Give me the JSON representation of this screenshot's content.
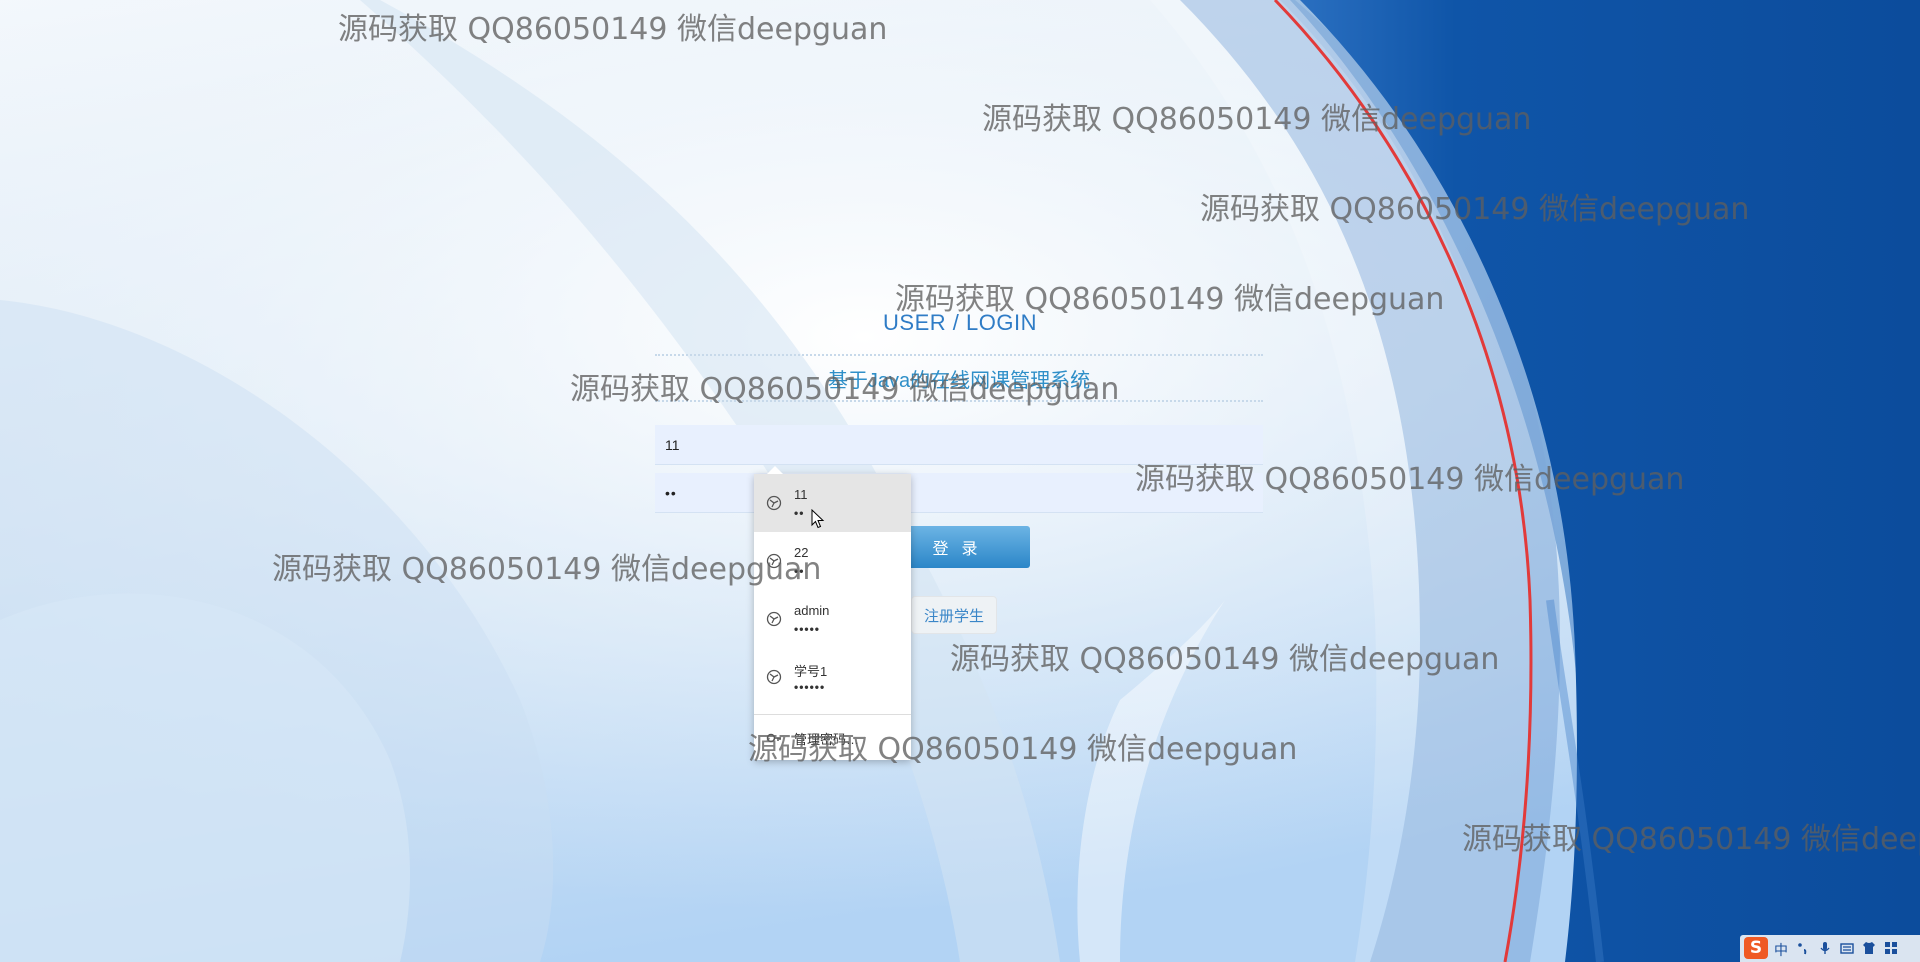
{
  "login": {
    "header": "USER / LOGIN",
    "system_title": "基于Java的在线网课管理系统",
    "username_value": "11",
    "password_value": "••",
    "login_button": "登 录",
    "register_button": "注册学生"
  },
  "autofill": {
    "items": [
      {
        "username": "11",
        "password": "••"
      },
      {
        "username": "22",
        "password": "••"
      },
      {
        "username": "admin",
        "password": "•••••"
      },
      {
        "username": "学号1",
        "password": "••••••"
      }
    ],
    "manage_label": "管理密码…"
  },
  "watermark_text": "源码获取 QQ86050149 微信deepguan",
  "ime": {
    "logo": "S",
    "language": "中",
    "icons": [
      "punctuation-icon",
      "microphone-icon",
      "keyboard-icon",
      "skin-icon",
      "toolbox-icon"
    ]
  },
  "colors": {
    "accent": "#2f7cc6",
    "dark_blue": "#0f4a99",
    "red_arc": "#e23a3a",
    "login_button": "#2b86c8"
  }
}
